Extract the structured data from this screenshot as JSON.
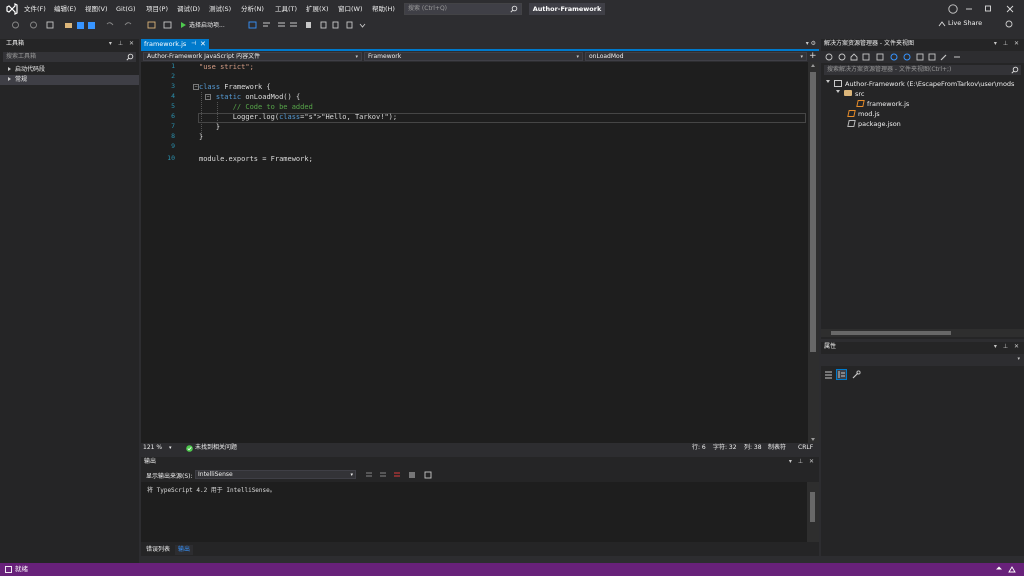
{
  "titlebar": {
    "menus": [
      "文件(F)",
      "编辑(E)",
      "视图(V)",
      "Git(G)",
      "项目(P)",
      "调试(D)",
      "测试(S)",
      "分析(N)",
      "工具(T)",
      "扩展(X)",
      "窗口(W)",
      "帮助(H)"
    ],
    "search_placeholder": "搜索 (Ctrl+Q)",
    "solution_name": "Author-Framework"
  },
  "toolbar": {
    "start_label": "选择启动项..."
  },
  "liveshare": "Live Share",
  "toolbox": {
    "title": "工具箱",
    "search_placeholder": "搜索工具箱",
    "items": [
      "启动代码段",
      "常规"
    ]
  },
  "editor": {
    "tab_name": "framework.js",
    "nav": {
      "scope": "Author-Framework JavaScript 内容文件",
      "class": "Framework",
      "member": "onLoadMod"
    },
    "lines": [
      {
        "n": "1",
        "text": "\"use strict\";"
      },
      {
        "n": "2",
        "text": ""
      },
      {
        "n": "3",
        "text": "class Framework {"
      },
      {
        "n": "4",
        "text": "    static onLoadMod() {"
      },
      {
        "n": "5",
        "text": "        // Code to be added"
      },
      {
        "n": "6",
        "text": "        Logger.log(\"Hello, Tarkov!\");"
      },
      {
        "n": "7",
        "text": "    }"
      },
      {
        "n": "8",
        "text": "}"
      },
      {
        "n": "9",
        "text": ""
      },
      {
        "n": "10",
        "text": "module.exports = Framework;"
      }
    ],
    "status": {
      "zoom": "121 %",
      "issues": "未找到相关问题",
      "line": "行: 6",
      "char": "字符: 32",
      "col": "列: 38",
      "tabs": "制表符",
      "eol": "CRLF"
    }
  },
  "output": {
    "title": "输出",
    "source_label": "显示输出来源(S):",
    "source_value": "IntelliSense",
    "text": "将 TypeScript 4.2 用于 IntelliSense。",
    "tabs": [
      "错误列表",
      "输出"
    ]
  },
  "solution_explorer": {
    "title": "解决方案资源管理器 - 文件夹视图",
    "search_placeholder": "搜索解决方案资源管理器 - 文件夹视图(Ctrl+;)",
    "root": "Author-Framework (E:\\EscapeFromTarkov\\user\\mods",
    "folder": "src",
    "files": [
      "framework.js",
      "mod.js",
      "package.json"
    ]
  },
  "properties": {
    "title": "属性"
  },
  "statusbar": {
    "text": "就绪"
  },
  "colors": {
    "accent": "#007acc",
    "statusbar": "#68217a",
    "keyword": "#569cd6",
    "string": "#d69d85",
    "comment": "#57a64a",
    "linenumber": "#2b91af"
  }
}
